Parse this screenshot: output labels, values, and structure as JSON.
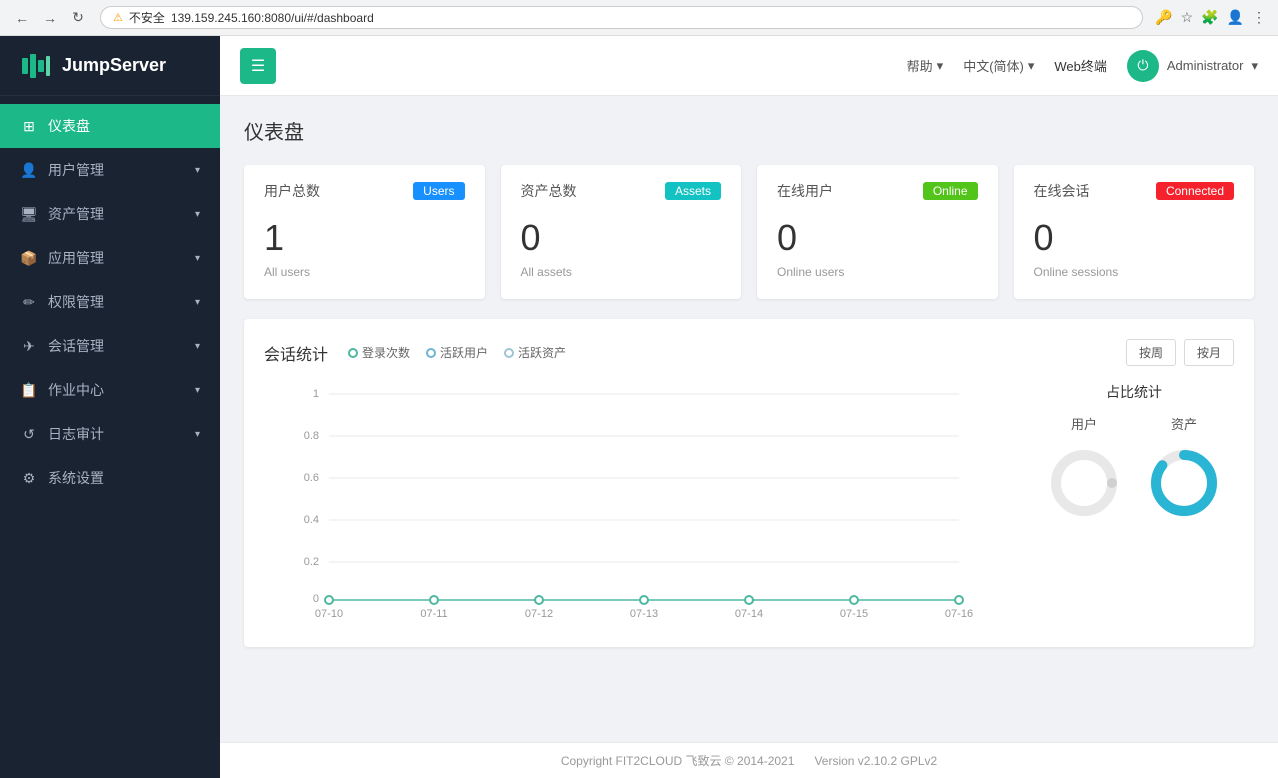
{
  "browser": {
    "address": "139.159.245.160:8080/ui/#/dashboard",
    "security_label": "不安全"
  },
  "sidebar": {
    "logo_text": "JumpServer",
    "items": [
      {
        "id": "dashboard",
        "label": "仪表盘",
        "icon": "⊞",
        "active": true,
        "has_children": false
      },
      {
        "id": "user-mgmt",
        "label": "用户管理",
        "icon": "👤",
        "active": false,
        "has_children": true
      },
      {
        "id": "asset-mgmt",
        "label": "资产管理",
        "icon": "🖥",
        "active": false,
        "has_children": true
      },
      {
        "id": "app-mgmt",
        "label": "应用管理",
        "icon": "📦",
        "active": false,
        "has_children": true
      },
      {
        "id": "perm-mgmt",
        "label": "权限管理",
        "icon": "✏",
        "active": false,
        "has_children": true
      },
      {
        "id": "session-mgmt",
        "label": "会话管理",
        "icon": "✈",
        "active": false,
        "has_children": true
      },
      {
        "id": "task-center",
        "label": "作业中心",
        "icon": "📋",
        "active": false,
        "has_children": true
      },
      {
        "id": "audit",
        "label": "日志审计",
        "icon": "↺",
        "active": false,
        "has_children": true
      },
      {
        "id": "system-settings",
        "label": "系统设置",
        "icon": "⚙",
        "active": false,
        "has_children": false
      }
    ]
  },
  "topbar": {
    "menu_icon": "☰",
    "help_label": "帮助",
    "language_label": "中文(简体)",
    "terminal_label": "Web终端",
    "admin_label": "Administrator",
    "admin_icon": "⏻"
  },
  "page": {
    "title": "仪表盘"
  },
  "stats": [
    {
      "id": "users",
      "label": "用户总数",
      "badge": "Users",
      "badge_class": "badge-users",
      "value": "1",
      "sub": "All users"
    },
    {
      "id": "assets",
      "label": "资产总数",
      "badge": "Assets",
      "badge_class": "badge-assets",
      "value": "0",
      "sub": "All assets"
    },
    {
      "id": "online",
      "label": "在线用户",
      "badge": "Online",
      "badge_class": "badge-online",
      "value": "0",
      "sub": "Online users"
    },
    {
      "id": "sessions",
      "label": "在线会话",
      "badge": "Connected",
      "badge_class": "badge-connected",
      "value": "0",
      "sub": "Online sessions"
    }
  ],
  "chart": {
    "title": "会话统计",
    "legend": [
      {
        "label": "登录次数",
        "color": "#4db8a0"
      },
      {
        "label": "活跃用户",
        "color": "#6eb5d4"
      },
      {
        "label": "活跃资产",
        "color": "#a0c4d4"
      }
    ],
    "btn_week": "按周",
    "btn_month": "按月",
    "x_labels": [
      "07-10",
      "07-11",
      "07-12",
      "07-13",
      "07-14",
      "07-15",
      "07-16"
    ],
    "y_labels": [
      "0",
      "0.2",
      "0.4",
      "0.6",
      "0.8",
      "1"
    ],
    "ratio_title": "占比统计",
    "ratio_user_label": "用户",
    "ratio_asset_label": "资产"
  },
  "footer": {
    "text": "Copyright FIT2CLOUD 飞致云 © 2014-2021",
    "version": "Version v2.10.2 GPLv2"
  }
}
